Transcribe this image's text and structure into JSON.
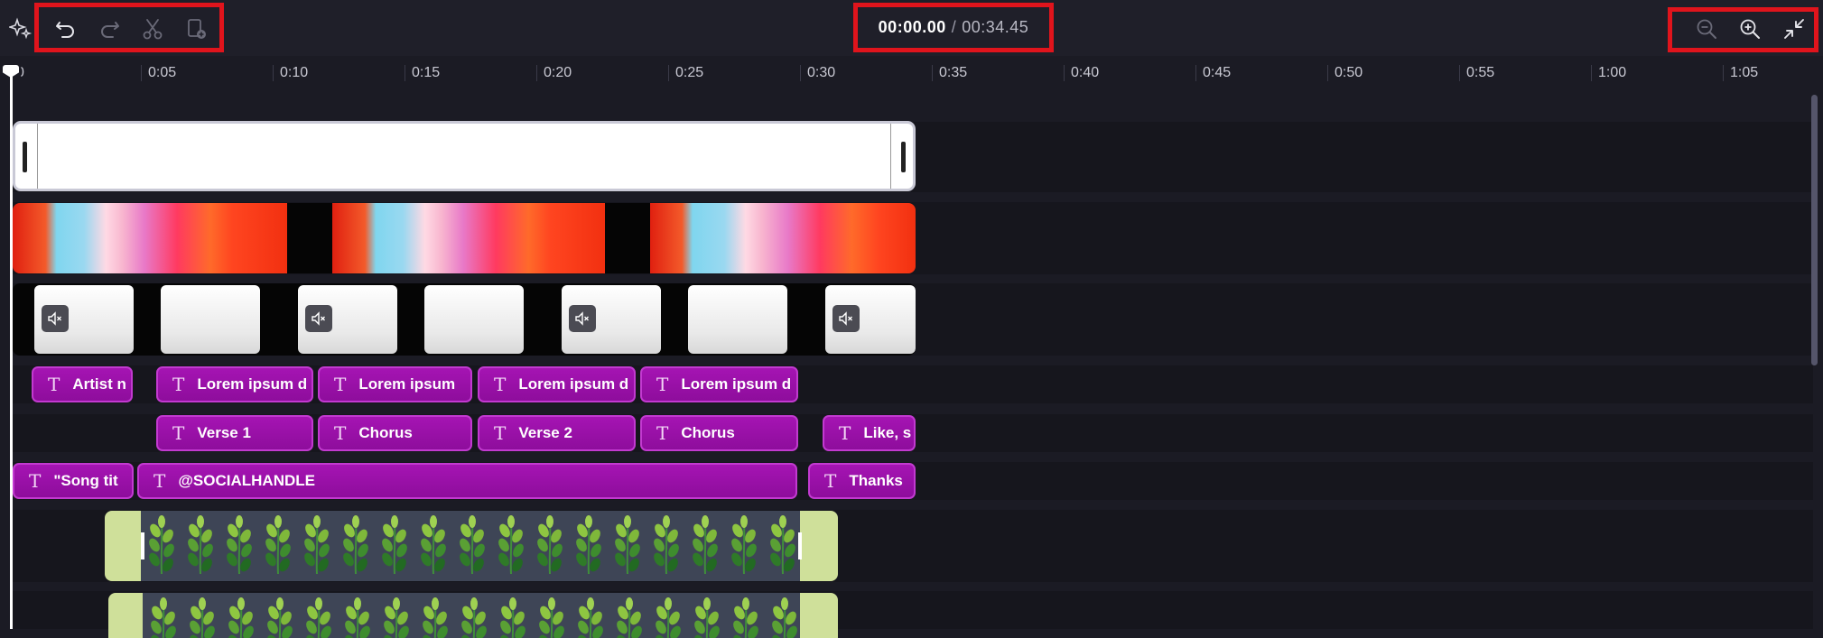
{
  "toolbar": {
    "magic_icon": "sparkle-icon",
    "undo_icon": "undo-icon",
    "redo_icon": "redo-icon",
    "split_icon": "scissors-icon",
    "duplicate_icon": "duplicate-icon",
    "zoom_out_icon": "zoom-out-icon",
    "zoom_in_icon": "zoom-in-icon",
    "fit_icon": "collapse-icon"
  },
  "playback": {
    "current_time": "00:00.00",
    "separator": "/",
    "total_time": "00:34.45"
  },
  "ruler": {
    "ticks": [
      "0",
      "0:05",
      "0:10",
      "0:15",
      "0:20",
      "0:25",
      "0:30",
      "0:35",
      "0:40",
      "0:45",
      "0:50",
      "0:55",
      "1:00",
      "1:05"
    ]
  },
  "tracks": {
    "text_row1": [
      "Artist n",
      "Lorem ipsum d",
      "Lorem ipsum",
      "Lorem ipsum d",
      "Lorem ipsum d"
    ],
    "text_row2": [
      "Verse 1",
      "Chorus",
      "Verse 2",
      "Chorus",
      "Like, s"
    ],
    "text_row3": [
      "\"Song tit",
      "@SOCIALHANDLE",
      "Thanks"
    ]
  },
  "colors": {
    "highlight": "#e0141c",
    "text_clip": "#a514b3",
    "sticker_bg": "#cfe09a"
  }
}
